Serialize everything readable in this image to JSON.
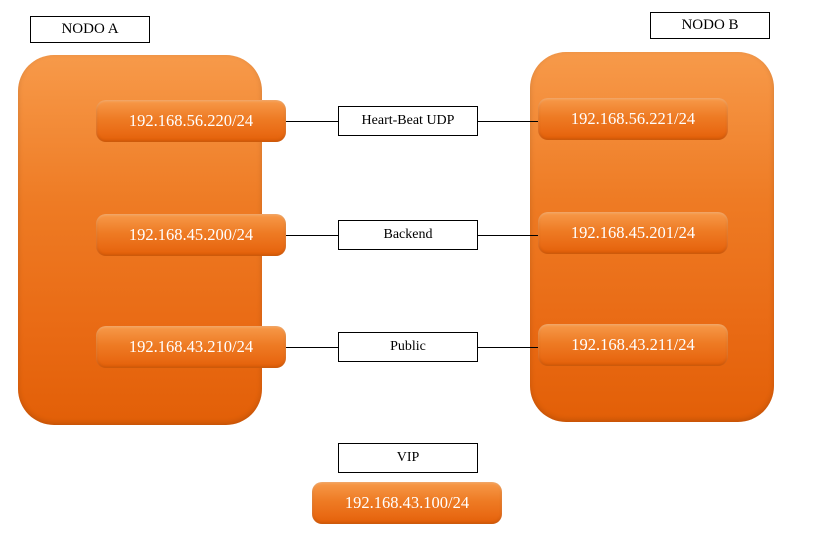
{
  "nodeA": {
    "title": "NODO A"
  },
  "nodeB": {
    "title": "NODO B"
  },
  "rows": [
    {
      "left_ip": "192.168.56.220/24",
      "right_ip": "192.168.56.221/24",
      "link": "Heart-Beat  UDP"
    },
    {
      "left_ip": "192.168.45.200/24",
      "right_ip": "192.168.45.201/24",
      "link": "Backend"
    },
    {
      "left_ip": "192.168.43.210/24",
      "right_ip": "192.168.43.211/24",
      "link": "Public"
    }
  ],
  "vip": {
    "label": "VIP",
    "ip": "192.168.43.100/24"
  }
}
